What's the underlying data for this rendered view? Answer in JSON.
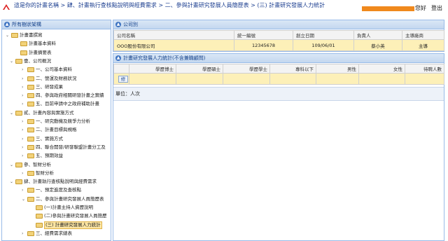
{
  "header": {
    "breadcrumb": [
      "這是你的計畫名稱",
      "肆、計畫執行查核點說明與經費需求",
      "二、參與計畫研究發展人員簡歷表",
      "(三) 計畫研究發展人力統計"
    ],
    "breadcrumb_separator": ">",
    "greeting": "您好",
    "logout": "登出",
    "redaction_color": "#f0891d"
  },
  "left_panel": {
    "title": "所有樹狀架構",
    "toggle_icon": "collapse-up-icon",
    "tree": [
      {
        "label": "計畫書撰寫",
        "expanded": true
      },
      {
        "label": "計畫基本資料"
      },
      {
        "label": "計畫摘要表"
      },
      {
        "label": "壹、公司概況",
        "expanded": true
      },
      {
        "label": "一、公司基本資料"
      },
      {
        "label": "二、營運及財務狀況"
      },
      {
        "label": "三、研發成果"
      },
      {
        "label": "四、參與政府相關研發計畫之實績"
      },
      {
        "label": "五、目前申請中之政府補助計畫"
      },
      {
        "label": "貳、計畫內容與實施方式",
        "expanded": true
      },
      {
        "label": "一、研究動機及競爭力分析"
      },
      {
        "label": "二、計畫目標與規格"
      },
      {
        "label": "三、實施方式"
      },
      {
        "label": "四、聯合開發/研發聯盟計畫分工及"
      },
      {
        "label": "五、預期效益"
      },
      {
        "label": "參、智財分析",
        "expanded": true
      },
      {
        "label": "智財分析"
      },
      {
        "label": "肆、計畫執行查核點說明與經費需求",
        "expanded": true
      },
      {
        "label": "一、預定進度及查核點"
      },
      {
        "label": "二、參與計畫研究發展人員簡歷表",
        "expanded": true
      },
      {
        "label": "(一)計畫主持人資歷說明"
      },
      {
        "label": "(二)參與計畫研究發展人員簡歷"
      },
      {
        "label": "(三) 計畫研究發展人力統計",
        "selected": true
      },
      {
        "label": "三、經費需求總表"
      }
    ]
  },
  "company_panel": {
    "title": "公司別",
    "columns": [
      "公司名稱",
      "統一編號",
      "創立日期",
      "負責人",
      "主導廠商"
    ],
    "row": [
      "OOO股份有限公司",
      "12345678",
      "109/06/01",
      "蔡小英",
      "主導"
    ]
  },
  "stats_panel": {
    "title": "計畫研究發展人力統計(不含兼職顧問)",
    "columns": [
      "學歷博士",
      "學歷碩士",
      "學歷學士",
      "專科以下",
      "男性",
      "女性",
      "待聘人數"
    ],
    "edit_label": "修",
    "unit_label": "單位：人次"
  }
}
